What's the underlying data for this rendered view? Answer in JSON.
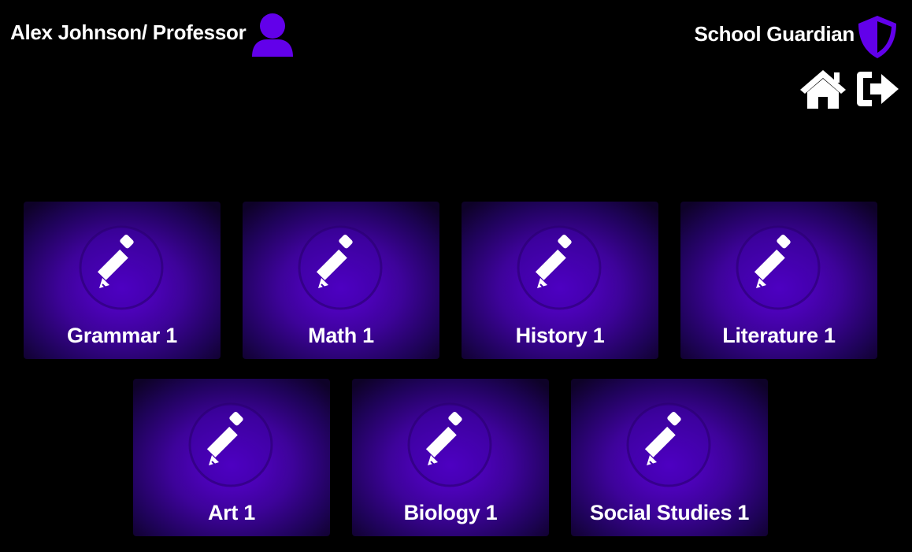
{
  "header": {
    "user_label": "Alex Johnson/ Professor",
    "avatar_icon": "user-icon",
    "brand_name": "School Guardian",
    "brand_icon": "shield-icon"
  },
  "nav": {
    "home_icon": "home-icon",
    "logout_icon": "logout-icon"
  },
  "colors": {
    "background": "#000000",
    "accent": "#6200ea",
    "card_center": "#5a00d6",
    "card_edge": "#0e0228",
    "text": "#ffffff"
  },
  "courses": [
    {
      "label": "Grammar 1",
      "icon": "pencil-icon"
    },
    {
      "label": "Math 1",
      "icon": "pencil-icon"
    },
    {
      "label": "History 1",
      "icon": "pencil-icon"
    },
    {
      "label": "Literature 1",
      "icon": "pencil-icon"
    },
    {
      "label": "Art 1",
      "icon": "pencil-icon"
    },
    {
      "label": "Biology 1",
      "icon": "pencil-icon"
    },
    {
      "label": "Social Studies 1",
      "icon": "pencil-icon"
    }
  ]
}
